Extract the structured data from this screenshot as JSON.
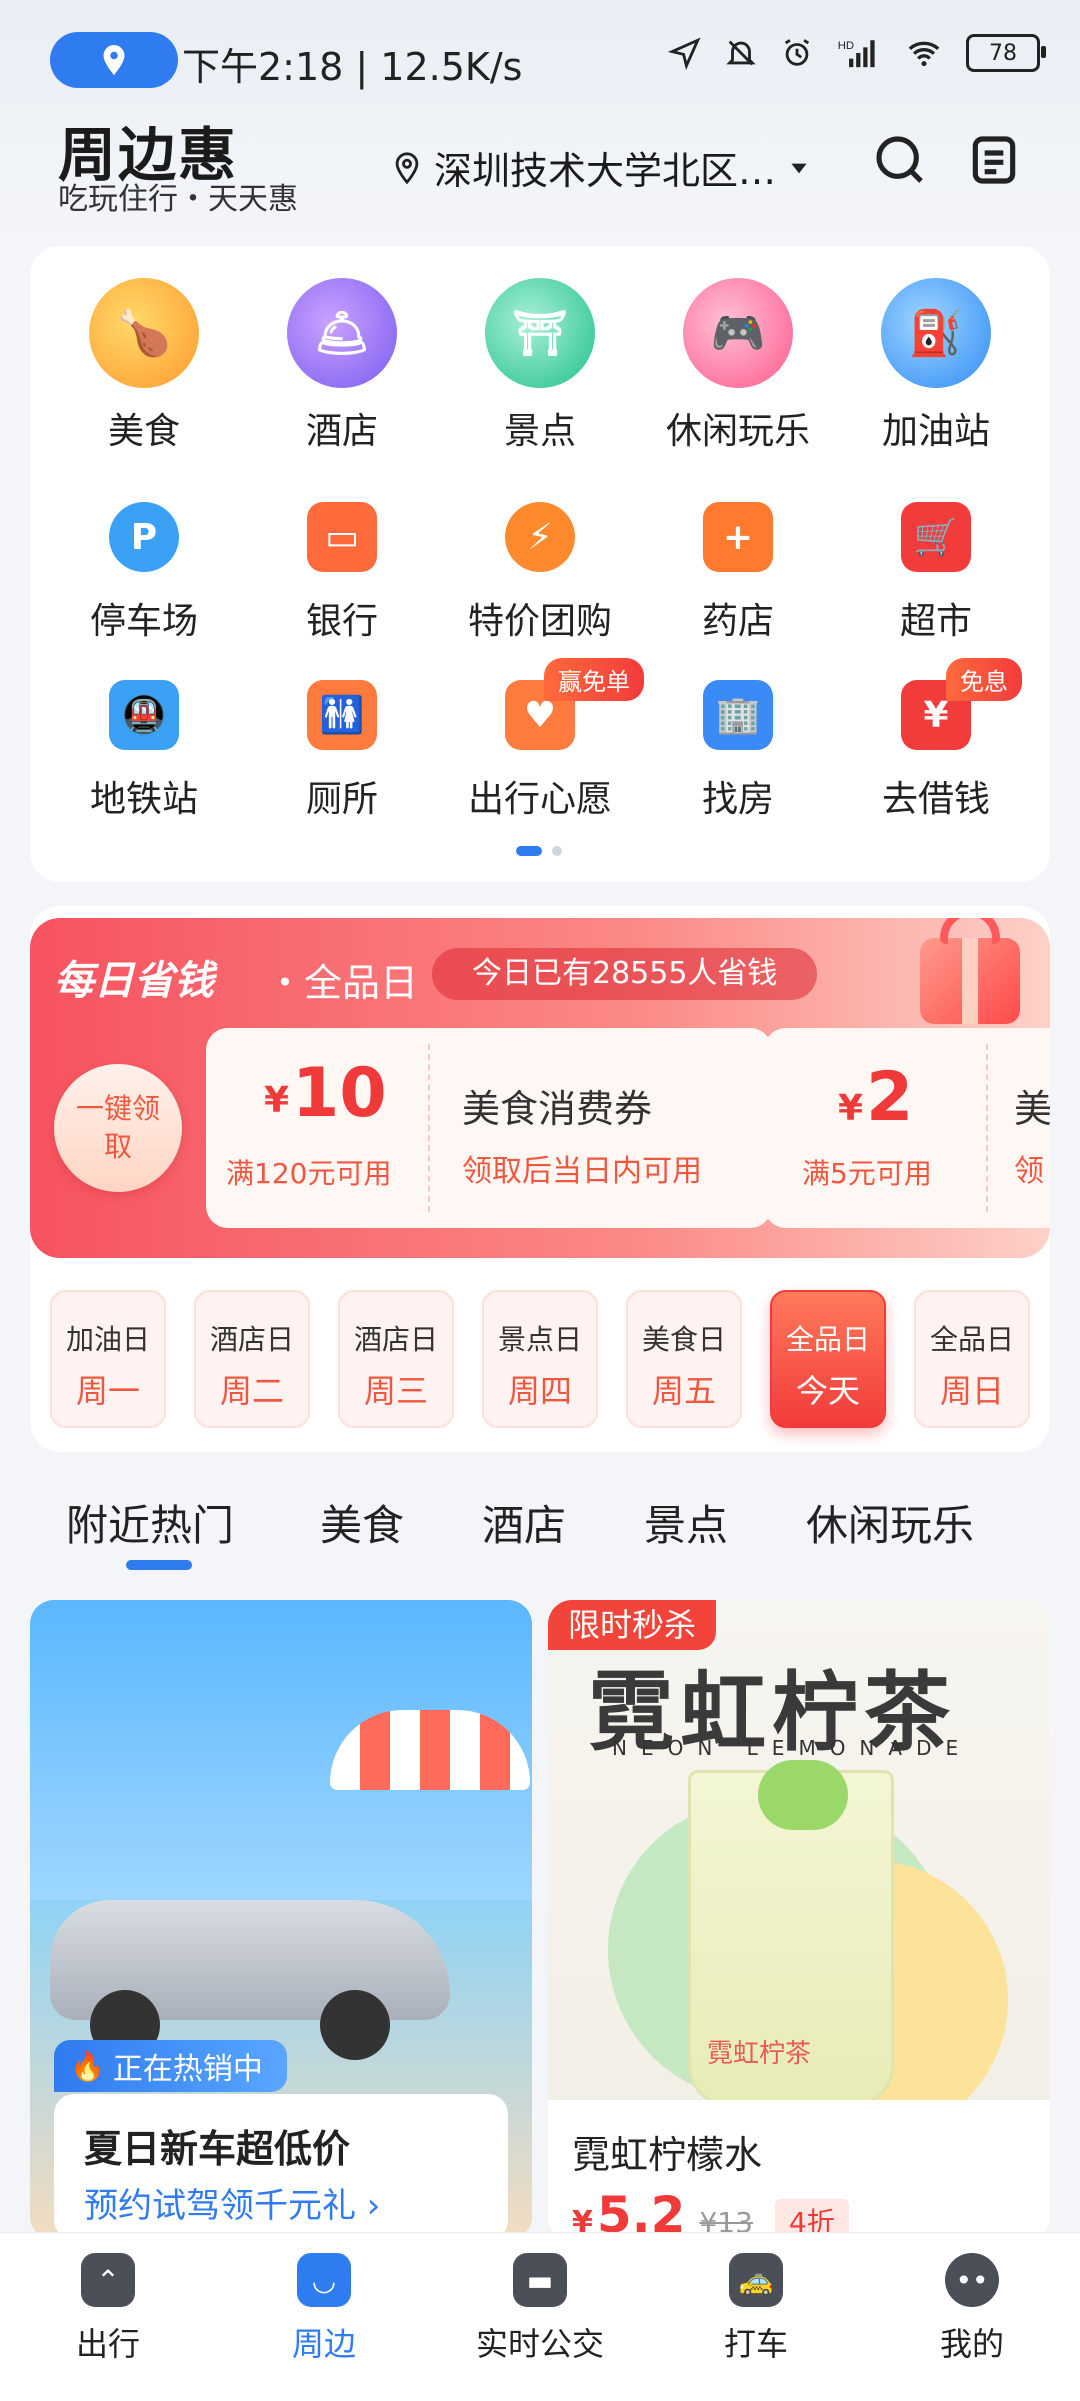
{
  "status_bar": {
    "time": "下午2:18 | 12.5K/s",
    "battery": "78"
  },
  "header": {
    "brand": "周边惠",
    "slogan": "吃玩住行・天天惠",
    "location": "深圳技术大学北区…"
  },
  "categories": [
    {
      "label": "美食"
    },
    {
      "label": "酒店"
    },
    {
      "label": "景点"
    },
    {
      "label": "休闲玩乐"
    },
    {
      "label": "加油站"
    },
    {
      "label": "停车场"
    },
    {
      "label": "银行"
    },
    {
      "label": "特价团购"
    },
    {
      "label": "药店"
    },
    {
      "label": "超市"
    },
    {
      "label": "地铁站"
    },
    {
      "label": "厕所"
    },
    {
      "label": "出行心愿"
    },
    {
      "label": "找房"
    },
    {
      "label": "去借钱"
    }
  ],
  "category_tags": {
    "wish": "赢免单",
    "loan": "免息"
  },
  "promo": {
    "title": "每日省钱",
    "day_label": "・全品日",
    "savers": "今日已有28555人省钱",
    "claim_button": "一键领取",
    "coupon1": {
      "amount": "10",
      "currency": "¥",
      "condition": "满120元可用",
      "name": "美食消费券",
      "desc": "领取后当日内可用"
    },
    "coupon2": {
      "amount": "2",
      "currency": "¥",
      "condition": "满5元可用",
      "name": "美",
      "desc": "领"
    }
  },
  "weekdays": [
    {
      "type": "加油日",
      "day": "周一"
    },
    {
      "type": "酒店日",
      "day": "周二"
    },
    {
      "type": "酒店日",
      "day": "周三"
    },
    {
      "type": "景点日",
      "day": "周四"
    },
    {
      "type": "美食日",
      "day": "周五"
    },
    {
      "type": "全品日",
      "day": "今天"
    },
    {
      "type": "全品日",
      "day": "周日"
    }
  ],
  "tabs": [
    "附近热门",
    "美食",
    "酒店",
    "景点",
    "休闲玩乐"
  ],
  "feed": {
    "left": {
      "badge": "正在热销中",
      "title": "夏日新车超低价",
      "subtitle": "预约试驾领千元礼 ›"
    },
    "right": {
      "badge": "限时秒杀",
      "brand_cn": "霓虹柠茶",
      "brand_en": "NEON LEMONADE",
      "cup_brand": "霓虹柠茶",
      "title": "霓虹柠檬水",
      "price": "5.2",
      "currency": "¥",
      "orig_price": "¥13",
      "discount": "4折"
    }
  },
  "bottom_nav": [
    {
      "label": "出行"
    },
    {
      "label": "周边"
    },
    {
      "label": "实时公交"
    },
    {
      "label": "打车"
    },
    {
      "label": "我的"
    }
  ],
  "colors": {
    "accent": "#2f7bf0",
    "promo_red": "#f6535f",
    "price_red": "#f03a3a"
  }
}
